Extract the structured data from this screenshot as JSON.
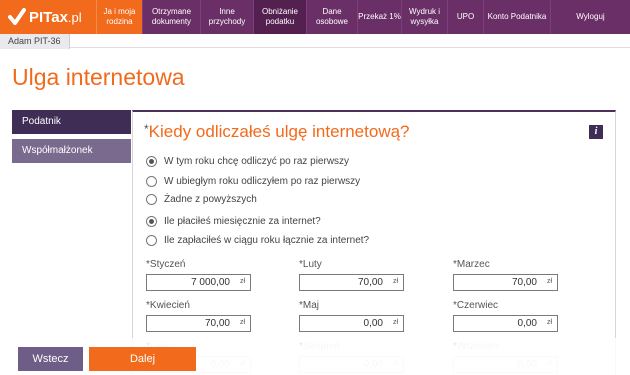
{
  "header": {
    "logo_text": "PITax",
    "logo_suffix": ".pl",
    "nav": [
      {
        "label": "Ja i moja rodzina",
        "width": 46,
        "style": "orange"
      },
      {
        "label": "Otrzymane dokumenty",
        "width": 58,
        "style": "purple"
      },
      {
        "label": "Inne przychody",
        "width": 53,
        "style": "purple"
      },
      {
        "label": "Obniżanie podatku",
        "width": 53,
        "style": "active"
      },
      {
        "label": "Dane osobowe",
        "width": 51,
        "style": "purple"
      },
      {
        "label": "Przekaż 1%",
        "width": 44,
        "style": "purple"
      },
      {
        "label": "Wydruk i wysyłka",
        "width": 46,
        "style": "purple"
      },
      {
        "label": "UPO",
        "width": 36,
        "style": "purple"
      },
      {
        "label": "Konto Podatnika",
        "width": 67,
        "style": "purple"
      },
      {
        "label": "Wyloguj",
        "width": 80,
        "style": "purple"
      }
    ]
  },
  "user_tab": "Adam PIT-36",
  "page_title": "Ulga internetowa",
  "sidebar": {
    "items": [
      {
        "label": "Podatnik",
        "active": true
      },
      {
        "label": "Współmałżonek",
        "active": false
      }
    ]
  },
  "question": {
    "star": "*",
    "text": "Kiedy odliczałeś ulgę internetową?",
    "info": "i"
  },
  "options_when": [
    {
      "label": "W tym roku chcę odliczyć po raz pierwszy",
      "checked": true
    },
    {
      "label": "W ubiegłym roku odliczyłem po raz pierwszy",
      "checked": false
    },
    {
      "label": "Żadne z powyższych",
      "checked": false
    }
  ],
  "options_payment": [
    {
      "label": "Ile płaciłeś miesięcznie za internet?",
      "checked": true
    },
    {
      "label": "Ile zapłaciłeś w ciągu roku łącznie za internet?",
      "checked": false
    }
  ],
  "currency": "zł",
  "months": [
    {
      "label": "Styczeń",
      "value": "7 000,00",
      "faded": false
    },
    {
      "label": "Luty",
      "value": "70,00",
      "faded": false
    },
    {
      "label": "Marzec",
      "value": "70,00",
      "faded": false
    },
    {
      "label": "Kwiecień",
      "value": "70,00",
      "faded": false
    },
    {
      "label": "Maj",
      "value": "0,00",
      "faded": false
    },
    {
      "label": "Czerwiec",
      "value": "0,00",
      "faded": false
    },
    {
      "label": "Lipiec",
      "value": "0,00",
      "faded": true
    },
    {
      "label": "Sierpień",
      "value": "0,00",
      "faded": true
    },
    {
      "label": "Wrzesień",
      "value": "0,00",
      "faded": true
    }
  ],
  "buttons": {
    "back": "Wstecz",
    "next": "Dalej"
  },
  "colors": {
    "brand_orange": "#f26a1b",
    "nav_purple": "#6a2f67",
    "dark_purple": "#3f2d55"
  }
}
